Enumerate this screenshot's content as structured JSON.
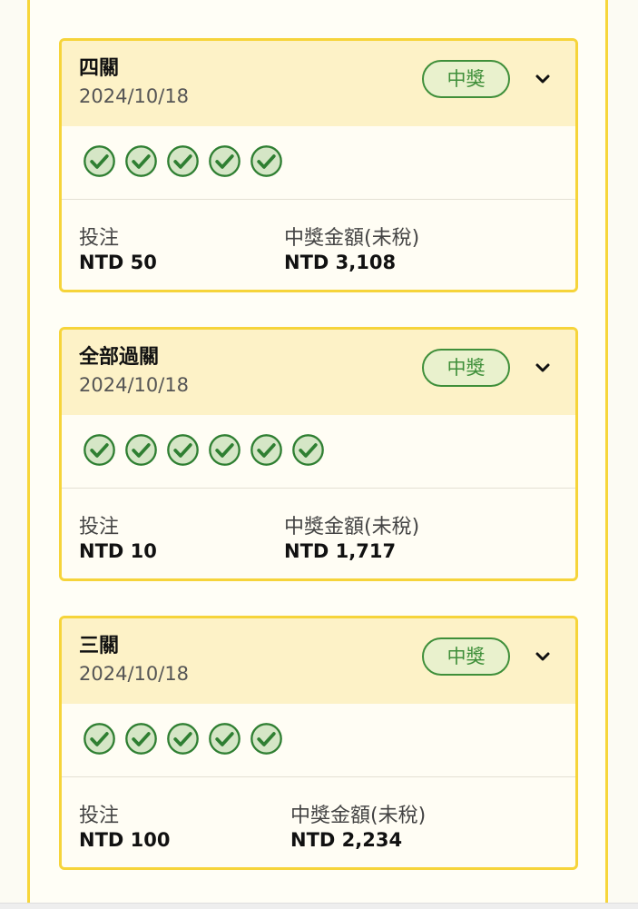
{
  "cards": [
    {
      "title": "四關",
      "date": "2024/10/18",
      "status": "中獎",
      "result_icons": [
        "check-circle-icon",
        "check-circle-icon",
        "check-circle-icon",
        "check-circle-icon",
        "check-circle-icon"
      ],
      "stake_label": "投注",
      "stake_value": "NTD 50",
      "prize_label": "中獎金額(未稅)",
      "prize_value": "NTD 3,108"
    },
    {
      "title": "全部過關",
      "date": "2024/10/18",
      "status": "中獎",
      "result_icons": [
        "check-circle-icon",
        "check-circle-icon",
        "check-circle-icon",
        "check-circle-icon",
        "check-circle-icon"
      ],
      "stake_label": "投注",
      "stake_value": "NTD 10",
      "prize_label": "中獎金額(未稅)",
      "prize_value": "NTD 1,717"
    },
    {
      "title": "三關",
      "date": "2024/10/18",
      "status": "中獎",
      "result_icons": [
        "check-circle-icon",
        "check-circle-icon",
        "check-circle-icon",
        "check-circle-icon",
        "check-circle-icon"
      ],
      "stake_label": "投注",
      "stake_value": "NTD 100",
      "prize_label": "中獎金額(未稅)",
      "prize_value": "NTD 2,234"
    }
  ],
  "colors": {
    "card_border": "#f6d43a",
    "card_header": "#fdf2c7",
    "win_green": "#3f8f3a",
    "badge_fill": "#e9f1cd"
  }
}
